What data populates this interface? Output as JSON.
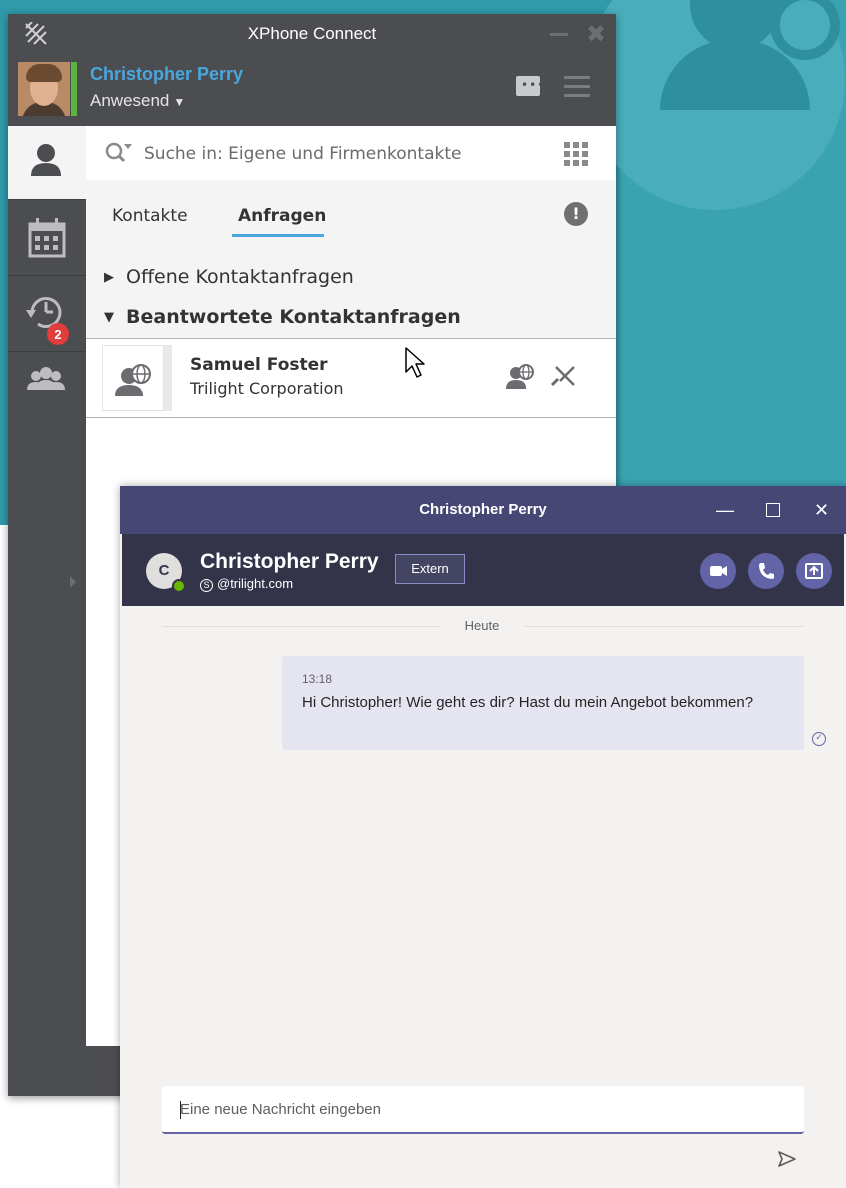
{
  "xphone": {
    "title": "XPhone Connect",
    "user_name": "Christopher Perry",
    "presence": "Anwesend",
    "presence_color": "#5bb440",
    "search_placeholder": "Suche in: Eigene und Firmenkontakte",
    "tabs": [
      {
        "label": "Kontakte",
        "active": false
      },
      {
        "label": "Anfragen",
        "active": true
      }
    ],
    "groups": [
      {
        "label": "Offene Kontaktanfragen",
        "expanded": false
      },
      {
        "label": "Beantwortete Kontaktanfragen",
        "expanded": true
      }
    ],
    "contact": {
      "name": "Samuel Foster",
      "company": "Trilight Corporation"
    },
    "sidebar": {
      "items": [
        {
          "icon": "person-icon",
          "active": true
        },
        {
          "icon": "calendar-icon",
          "active": false
        },
        {
          "icon": "history-icon",
          "active": false,
          "badge": "2"
        },
        {
          "icon": "group-icon",
          "active": false
        }
      ]
    },
    "accent_color": "#49a7de"
  },
  "teams": {
    "title": "Christopher Perry",
    "contact_name": "Christopher Perry",
    "contact_initial": "C",
    "contact_email": "@trilight.com",
    "extern_label": "Extern",
    "date_divider": "Heute",
    "messages": [
      {
        "time": "13:18",
        "text": "Hi Christopher! Wie geht es dir? Hast du mein Angebot bekommen?"
      }
    ],
    "compose_placeholder": "Eine neue Nachricht eingeben",
    "accent_color": "#6264a7",
    "header_color": "#464775"
  }
}
